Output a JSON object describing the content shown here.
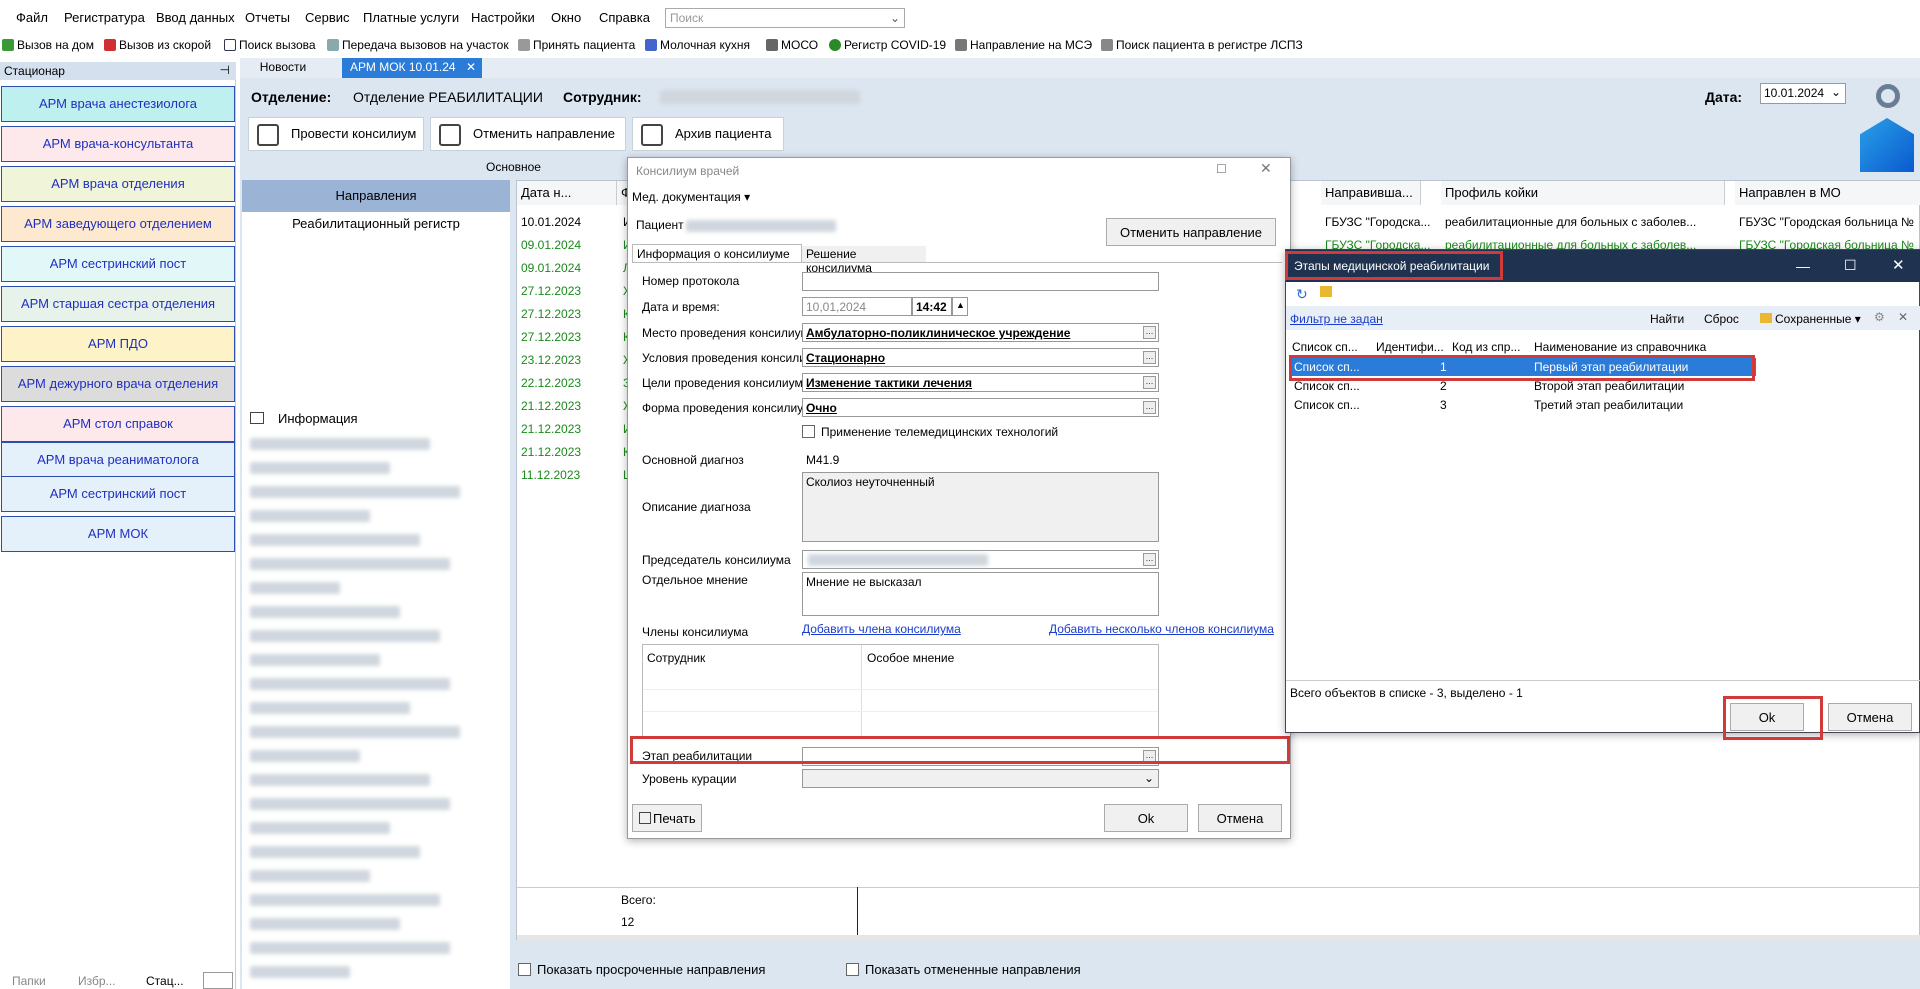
{
  "menu": [
    "Файл",
    "Регистратура",
    "Ввод данных",
    "Отчеты",
    "Сервис",
    "Платные услуги",
    "Настройки",
    "Окно",
    "Справка"
  ],
  "search": {
    "placeholder": "Поиск"
  },
  "toolbar": [
    "Вызов на дом",
    "Вызов из скорой",
    "Поиск вызова",
    "Передача вызовов на участок",
    "Принять пациента",
    "Молочная кухня",
    "МОСО",
    "Регистр COVID-19",
    "Направление на МСЭ",
    "Поиск пациента в регистре ЛСПЗ"
  ],
  "left_panel": {
    "title": "Стационар",
    "items": [
      {
        "label": "АРМ врача анестезиолога",
        "color": "#bff0f0"
      },
      {
        "label": "АРМ врача-консультанта",
        "color": "#fde8ec"
      },
      {
        "label": "АРМ врача отделения",
        "color": "#f0f4d8"
      },
      {
        "label": "АРМ заведующего отделением",
        "color": "#fde8d0"
      },
      {
        "label": "АРМ сестринский пост",
        "color": "#e2f8f8"
      },
      {
        "label": "АРМ старшая сестра отделения",
        "color": "#e6f2ea"
      },
      {
        "label": "АРМ ПДО",
        "color": "#fdf2c8"
      },
      {
        "label": "АРМ дежурного врача отделения",
        "color": "#dcdcdc"
      },
      {
        "label": "АРМ стол справок",
        "color": "#fde8ec"
      },
      {
        "label": "АРМ врача реаниматолога",
        "color": "#e4f0fa"
      },
      {
        "label": "АРМ сестринский пост",
        "color": "#e4f0fa"
      },
      {
        "label": "АРМ МОК",
        "color": "#e4f0fa"
      }
    ],
    "bottom_tabs": [
      "Папки",
      "Избр...",
      "Стац..."
    ]
  },
  "tabs": [
    "Новости",
    "АРМ МОК 10.01.24"
  ],
  "header": {
    "dept_label": "Отделение:",
    "dept_value": "Отделение РЕАБИЛИТАЦИИ",
    "emp_label": "Сотрудник:",
    "date_label": "Дата:",
    "date_value": "10.01.2024"
  },
  "actions": {
    "consilium": "Провести консилиум",
    "cancel_dir": "Отменить направление",
    "archive": "Архив пациента",
    "group": "Основное"
  },
  "left_tabs": {
    "directions": "Направления",
    "rehab": "Реабилитационный регистр",
    "info": "Информация"
  },
  "grid": {
    "headers": [
      "Дата н...",
      "Ф",
      "Направивша...",
      "Профиль койки",
      "Направлен в МО"
    ],
    "dates": [
      "10.01.2024",
      "09.01.2024",
      "09.01.2024",
      "27.12.2023",
      "27.12.2023",
      "27.12.2023",
      "23.12.2023",
      "22.12.2023",
      "21.12.2023",
      "21.12.2023",
      "21.12.2023",
      "11.12.2023"
    ],
    "initials": [
      "И",
      "И",
      "Л",
      "Ж",
      "К",
      "К",
      "Ж",
      "З",
      "Ж",
      "И",
      "К",
      "Ш"
    ],
    "first_rows": [
      {
        "sender": "ГБУЗС \"Городска...",
        "profile": "реабилитационные для больных с заболев...",
        "mo": "ГБУЗС \"Городская больница №"
      },
      {
        "sender": "ГБУЗС \"Городска...",
        "profile": "реабилитационные для больных с заболев...",
        "mo": "ГБУЗС \"Городская больница №"
      }
    ],
    "total_label": "Всего:",
    "total_value": "12",
    "show_overdue": "Показать просроченные направления",
    "show_cancelled": "Показать отмененные направления"
  },
  "consilium": {
    "title": "Консилиум врачей",
    "med_doc": "Мед. документация",
    "patient_label": "Пациент",
    "cancel_btn": "Отменить направление",
    "tab_info": "Информация о консилиуме",
    "tab_decision": "Решение консилиума",
    "protocol_label": "Номер протокола",
    "datetime_label": "Дата и время:",
    "date": "10,01,2024",
    "time": "14:42",
    "place_label": "Место проведения консилиума",
    "place_value": "Амбулаторно-поликлиническое учреждение",
    "conditions_label": "Условия проведения консилиума",
    "conditions_value": "Стационарно",
    "goals_label": "Цели проведения консилиума",
    "goals_value": "Изменение тактики лечения",
    "form_label": "Форма проведения консилиума",
    "form_value": "Очно",
    "telemed": "Применение телемедицинских технологий",
    "diag_label": "Основной диагноз",
    "diag_value": "M41.9",
    "diag_desc_label": "Описание диагноза",
    "diag_desc_value": "Сколиоз неуточненный",
    "chair_label": "Председатель консилиума",
    "opinion_label": "Отдельное мнение",
    "opinion_value": "Мнение не высказал",
    "members_label": "Члены консилиума",
    "add_member": "Добавить члена консилиума",
    "add_members": "Добавить несколько членов консилиума",
    "col_employee": "Сотрудник",
    "col_opinion": "Особое мнение",
    "stage_label": "Этап реабилитации",
    "curation_label": "Уровень курации",
    "print": "Печать",
    "ok": "Ok",
    "cancel": "Отмена"
  },
  "stages": {
    "title": "Этапы медицинской реабилитации",
    "filter": "Фильтр не задан",
    "find": "Найти",
    "reset": "Сброс",
    "saved": "Сохраненные",
    "headers": [
      "Список сп...",
      "Идентифи...",
      "Код из спр...",
      "Наименование из справочника"
    ],
    "rows": [
      {
        "list": "Список сп...",
        "id": "1",
        "name": "Первый этап реабилитации"
      },
      {
        "list": "Список сп...",
        "id": "2",
        "name": "Второй этап реабилитации"
      },
      {
        "list": "Список сп...",
        "id": "3",
        "name": "Третий этап реабилитации"
      }
    ],
    "footer": "Всего объектов в списке - 3, выделено - 1",
    "ok": "Ok",
    "cancel": "Отмена"
  }
}
